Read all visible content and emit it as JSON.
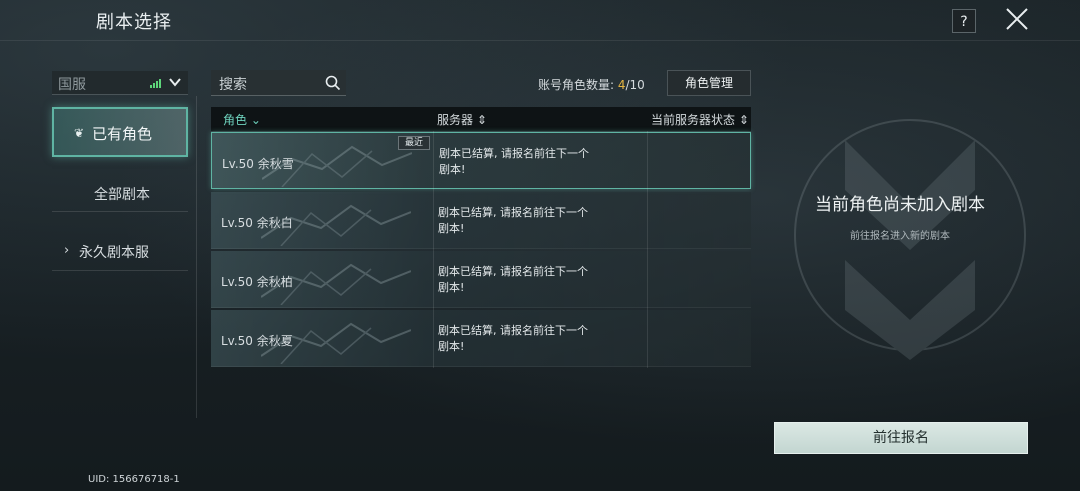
{
  "header": {
    "title": "剧本选择",
    "help_label": "?"
  },
  "sidebar": {
    "server": "国服",
    "tabs": [
      {
        "label": "已有角色"
      },
      {
        "label": "全部剧本"
      },
      {
        "label": "永久剧本服"
      }
    ],
    "uid": "UID: 156676718-1"
  },
  "toolbar": {
    "search_placeholder": "搜索",
    "count_label": "账号角色数量: ",
    "count_current": "4",
    "count_total": "/10",
    "manage_label": "角色管理"
  },
  "table": {
    "columns": [
      "角色",
      "服务器",
      "当前服务器状态"
    ],
    "recent_badge": "最近",
    "rows": [
      {
        "name": "Lv.50 余秋雪",
        "status": "剧本已结算, 请报名前往下一个剧本!"
      },
      {
        "name": "Lv.50 余秋白",
        "status": "剧本已结算, 请报名前往下一个剧本!"
      },
      {
        "name": "Lv.50 余秋柏",
        "status": "剧本已结算, 请报名前往下一个剧本!"
      },
      {
        "name": "Lv.50 余秋夏",
        "status": "剧本已结算, 请报名前往下一个剧本!"
      }
    ]
  },
  "detail": {
    "title": "当前角色尚未加入剧本",
    "subtitle": "前往报名进入新的剧本",
    "button_label": "前往报名"
  },
  "colors": {
    "accent": "#5fb4a3",
    "highlight": "#e5b542"
  }
}
